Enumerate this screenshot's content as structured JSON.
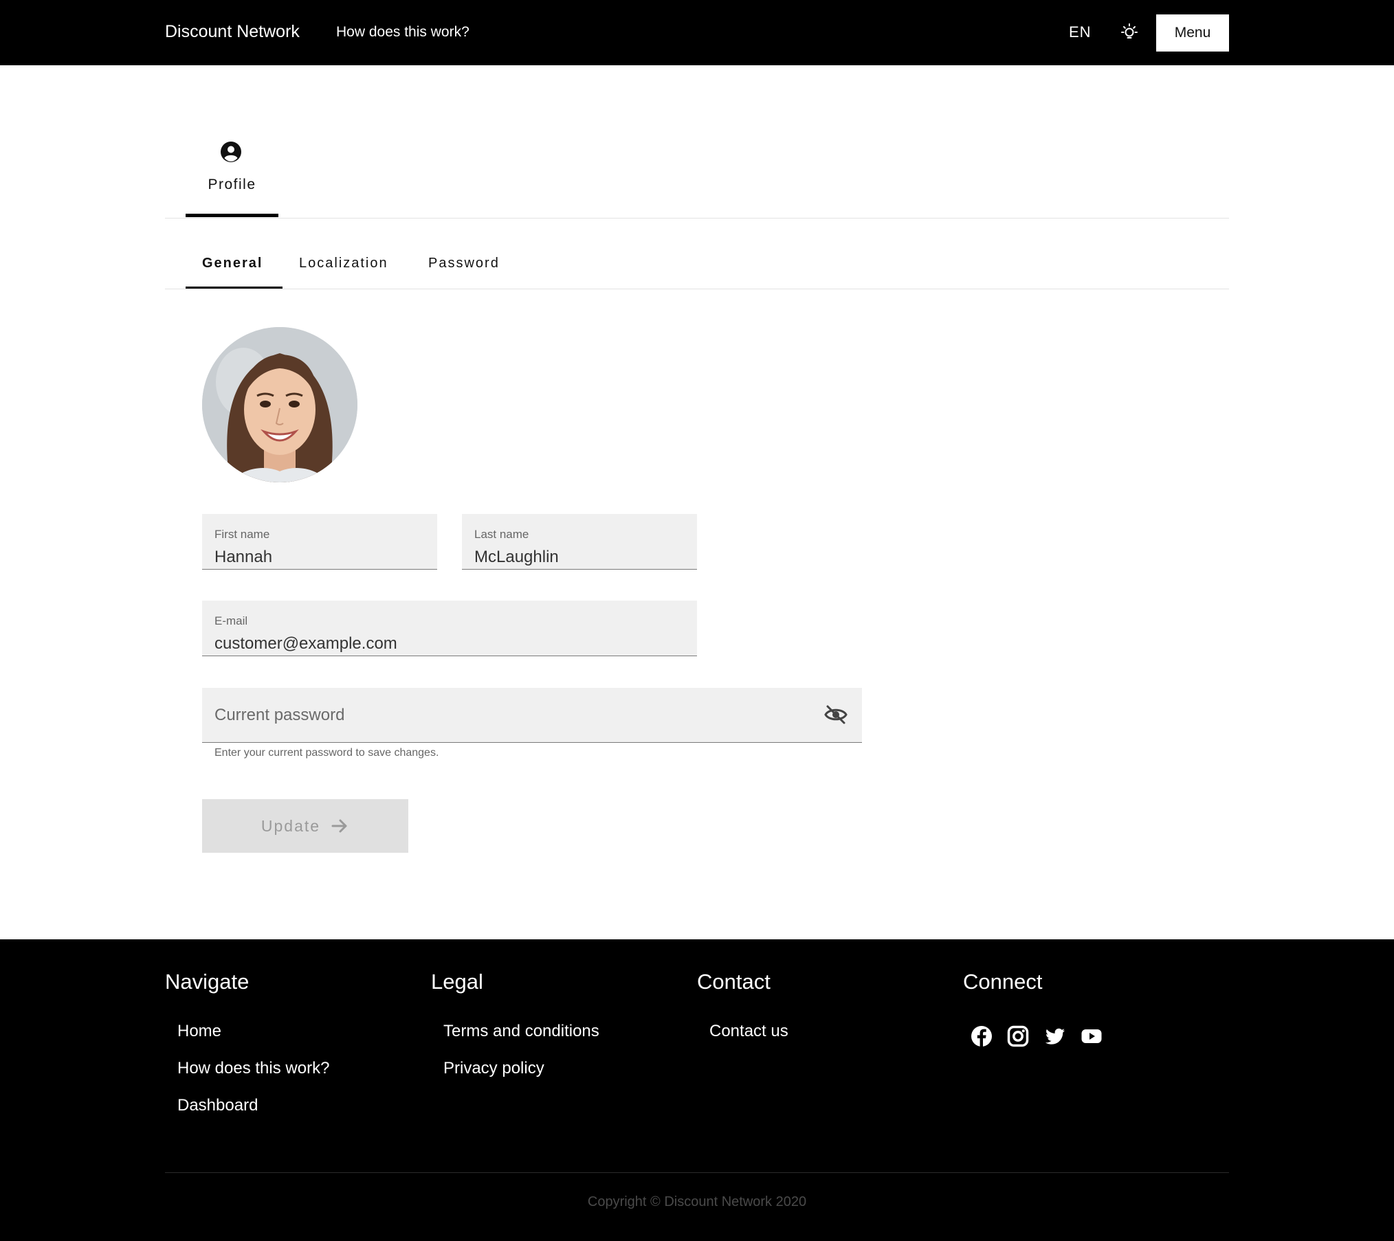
{
  "header": {
    "brand": "Discount Network",
    "how_link": "How does this work?",
    "language": "EN",
    "menu_label": "Menu"
  },
  "profile_tab": {
    "label": "Profile",
    "icon": "account-circle-icon"
  },
  "sub_tabs": [
    {
      "label": "General",
      "active": true
    },
    {
      "label": "Localization",
      "active": false
    },
    {
      "label": "Password",
      "active": false
    }
  ],
  "form": {
    "first_name": {
      "label": "First name",
      "value": "Hannah"
    },
    "last_name": {
      "label": "Last name",
      "value": "McLaughlin"
    },
    "email": {
      "label": "E-mail",
      "value": "customer@example.com"
    },
    "current_password": {
      "placeholder": "Current password",
      "hint": "Enter your current password to save changes."
    },
    "update_label": "Update"
  },
  "footer": {
    "navigate": {
      "title": "Navigate",
      "links": [
        "Home",
        "How does this work?",
        "Dashboard"
      ]
    },
    "legal": {
      "title": "Legal",
      "links": [
        "Terms and conditions",
        "Privacy policy"
      ]
    },
    "contact": {
      "title": "Contact",
      "links": [
        "Contact us"
      ]
    },
    "connect": {
      "title": "Connect",
      "icons": [
        "facebook-icon",
        "instagram-icon",
        "twitter-icon",
        "youtube-icon"
      ]
    },
    "copyright": "Copyright © Discount Network 2020"
  },
  "colors": {
    "header_bg": "#000000",
    "field_bg": "#f0f0f0",
    "button_disabled_bg": "#e0e0e0"
  }
}
